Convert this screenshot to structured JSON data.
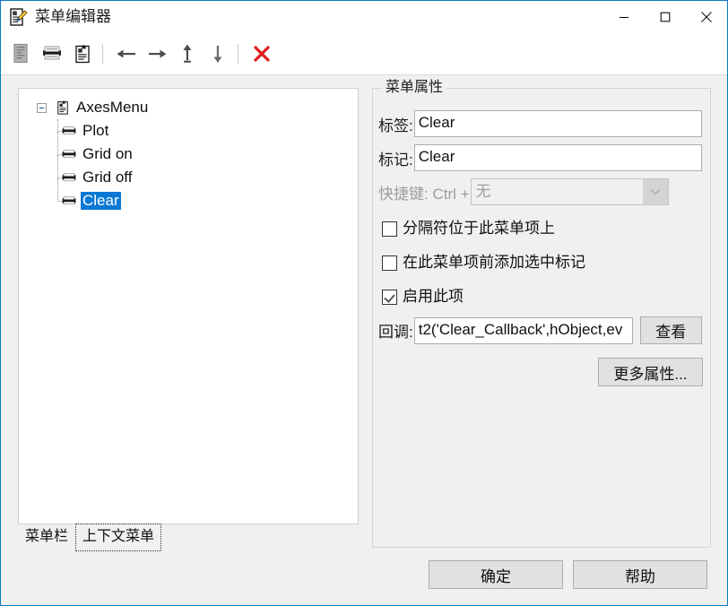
{
  "window": {
    "title": "菜单编辑器",
    "icon": "menu-editor-icon",
    "minimize_label": "—",
    "maximize_label": "□",
    "close_label": "✕"
  },
  "toolbar": {
    "items": [
      {
        "name": "new-menu-icon",
        "tooltip": "新建菜单",
        "disabled": true
      },
      {
        "name": "new-menubar-item-icon",
        "tooltip": "新建菜单栏项",
        "disabled": false
      },
      {
        "name": "new-context-menu-icon",
        "tooltip": "新建上下文菜单",
        "disabled": false
      },
      {
        "name": "move-left-icon",
        "tooltip": "左移",
        "disabled": false
      },
      {
        "name": "move-right-icon",
        "tooltip": "右移",
        "disabled": false
      },
      {
        "name": "move-up-icon",
        "tooltip": "上移",
        "disabled": false
      },
      {
        "name": "move-down-icon",
        "tooltip": "下移",
        "disabled": false
      },
      {
        "name": "delete-icon",
        "tooltip": "删除",
        "disabled": false
      }
    ]
  },
  "tree": {
    "root": {
      "label": "AxesMenu",
      "expanded": true,
      "icon": "menu-node-icon"
    },
    "children": [
      {
        "label": "Plot",
        "icon": "menu-item-icon",
        "selected": false
      },
      {
        "label": "Grid on",
        "icon": "menu-item-icon",
        "selected": false
      },
      {
        "label": "Grid off",
        "icon": "menu-item-icon",
        "selected": false
      },
      {
        "label": "Clear",
        "icon": "menu-item-icon",
        "selected": true
      }
    ]
  },
  "tabs": [
    {
      "label": "菜单栏",
      "active": true,
      "focused": false
    },
    {
      "label": "上下文菜单",
      "active": false,
      "focused": true
    }
  ],
  "properties": {
    "legend": "菜单属性",
    "label_field": {
      "label": "标签:",
      "value": "Clear"
    },
    "tag_field": {
      "label": "标记:",
      "value": "Clear"
    },
    "accelerator": {
      "label": "快捷键: Ctrl +",
      "value": "无",
      "disabled": true
    },
    "checkboxes": [
      {
        "label": "分隔符位于此菜单项上",
        "checked": false
      },
      {
        "label": "在此菜单项前添加选中标记",
        "checked": false
      },
      {
        "label": "启用此项",
        "checked": true
      }
    ],
    "callback": {
      "label": "回调:",
      "value": "t2('Clear_Callback',hObject,ev",
      "view_button": "查看"
    },
    "more_properties_button": "更多属性..."
  },
  "footer": {
    "ok_button": "确定",
    "help_button": "帮助"
  },
  "colors": {
    "accent": "#0a78d4",
    "titlebar_border": "#0a7cc0",
    "delete_red": "#e01b1b",
    "window_bg": "#f0f0f0"
  }
}
